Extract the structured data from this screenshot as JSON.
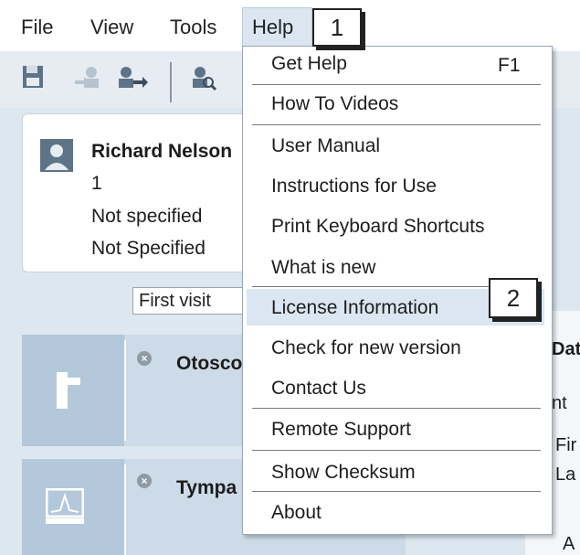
{
  "menubar": {
    "file": "File",
    "view": "View",
    "tools": "Tools",
    "help": "Help"
  },
  "patient": {
    "name": "Richard Nelson",
    "id": "1",
    "line2": "Not specified",
    "line3": "Not Specified"
  },
  "visit": {
    "selected": "First visit"
  },
  "modules": [
    {
      "title": "Otosco"
    },
    {
      "title": "Tympa"
    }
  ],
  "right_panel": {
    "heading": "Dat",
    "line1": "nt",
    "line2": "Fir",
    "line3": "La",
    "line4": "A"
  },
  "help_menu": {
    "items": [
      {
        "label": "Get Help",
        "shortcut": "F1"
      },
      {
        "label": "How To Videos"
      },
      {
        "label": "User Manual"
      },
      {
        "label": "Instructions for Use"
      },
      {
        "label": "Print Keyboard Shortcuts"
      },
      {
        "label": "What is new"
      },
      {
        "label": "License Information"
      },
      {
        "label": "Check for new version"
      },
      {
        "label": "Contact Us"
      },
      {
        "label": "Remote Support"
      },
      {
        "label": "Show Checksum"
      },
      {
        "label": "About"
      }
    ]
  },
  "callouts": {
    "first": "1",
    "second": "2"
  },
  "colors": {
    "menu_highlight": "#dae6f1",
    "toolbar_bg": "#e6ecf2",
    "panel_bg": "#dde7f0",
    "module_bg": "#cddbe8"
  }
}
